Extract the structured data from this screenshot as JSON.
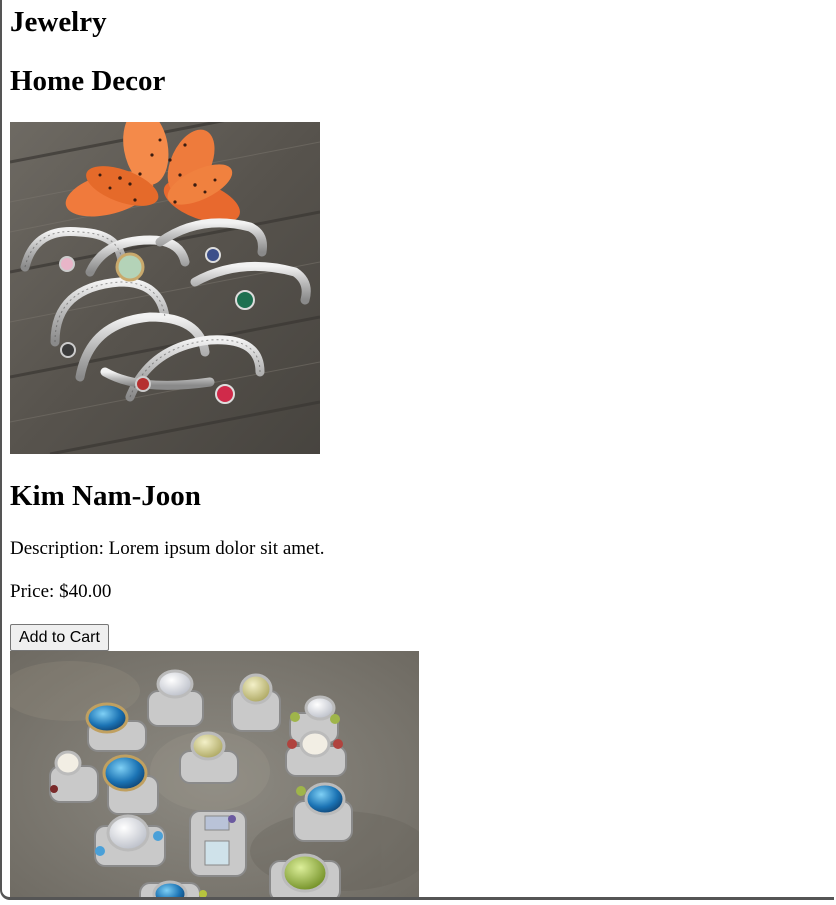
{
  "categories": {
    "jewelry": "Jewelry",
    "home_decor": "Home Decor"
  },
  "product": {
    "name": "Kim Nam-Joon",
    "description": "Description: Lorem ipsum dolor sit amet.",
    "price": "Price: $40.00",
    "add_to_cart_label": "Add to Cart"
  },
  "images": {
    "first": "silver-cuff-bracelets-with-gemstones-and-orange-lily",
    "second": "silver-rings-with-gemstones"
  }
}
